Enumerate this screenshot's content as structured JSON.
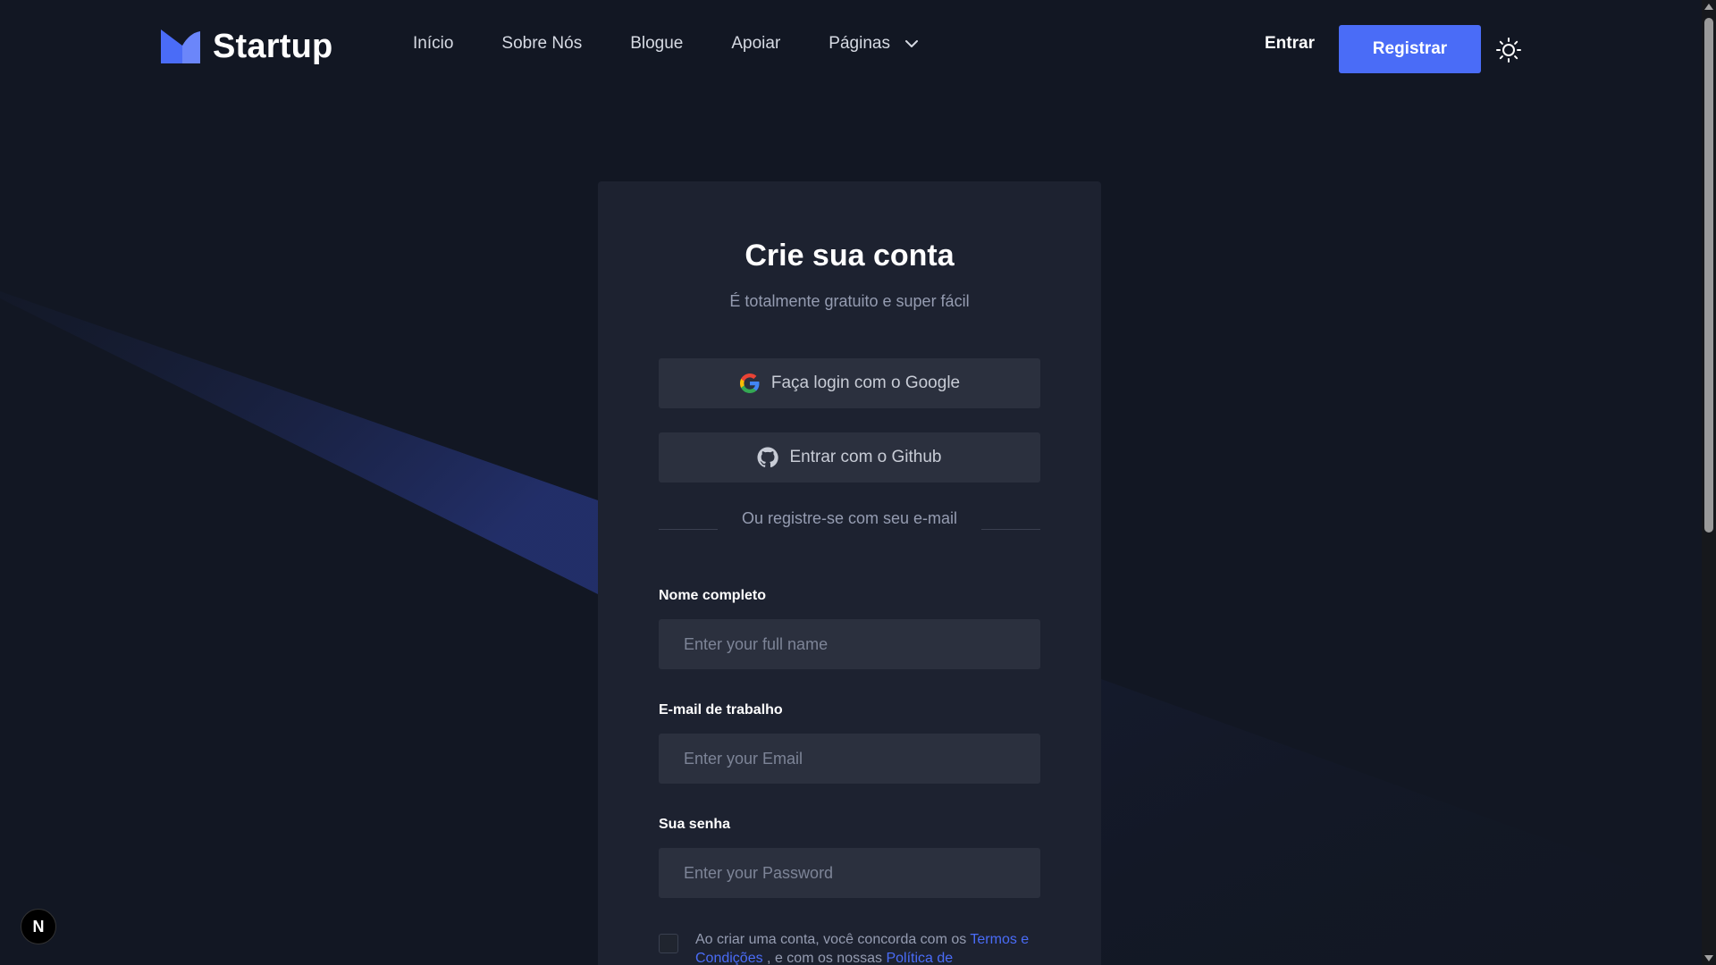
{
  "header": {
    "logo_text": "Startup",
    "nav": [
      {
        "label": "Início"
      },
      {
        "label": "Sobre Nós"
      },
      {
        "label": "Blogue"
      },
      {
        "label": "Apoiar"
      },
      {
        "label": "Páginas"
      }
    ],
    "signin_label": "Entrar",
    "register_label": "Registrar",
    "theme_icon": "sun-icon"
  },
  "card": {
    "title": "Crie sua conta",
    "subtitle": "É totalmente gratuito e super fácil",
    "google_label": "Faça login com o Google",
    "github_label": "Entrar com o Github",
    "divider_text": "Ou registre-se com seu e-mail",
    "fields": {
      "name": {
        "label": "Nome completo",
        "placeholder": "Enter your full name",
        "value": ""
      },
      "email": {
        "label": "E-mail de trabalho",
        "placeholder": "Enter your Email",
        "value": ""
      },
      "password": {
        "label": "Sua senha",
        "placeholder": "Enter your Password",
        "value": ""
      }
    },
    "terms": {
      "prefix": "Ao criar uma conta, você concorda com os ",
      "terms_link": "Termos e Condições",
      "middle": " , e com os nossas ",
      "privacy_link": "Política de"
    }
  },
  "badge": {
    "label": "N"
  },
  "colors": {
    "background": "#121723",
    "card": "#1d2230",
    "input": "#2b303e",
    "accent": "#4a6cf7",
    "muted_text": "#959cb1"
  }
}
